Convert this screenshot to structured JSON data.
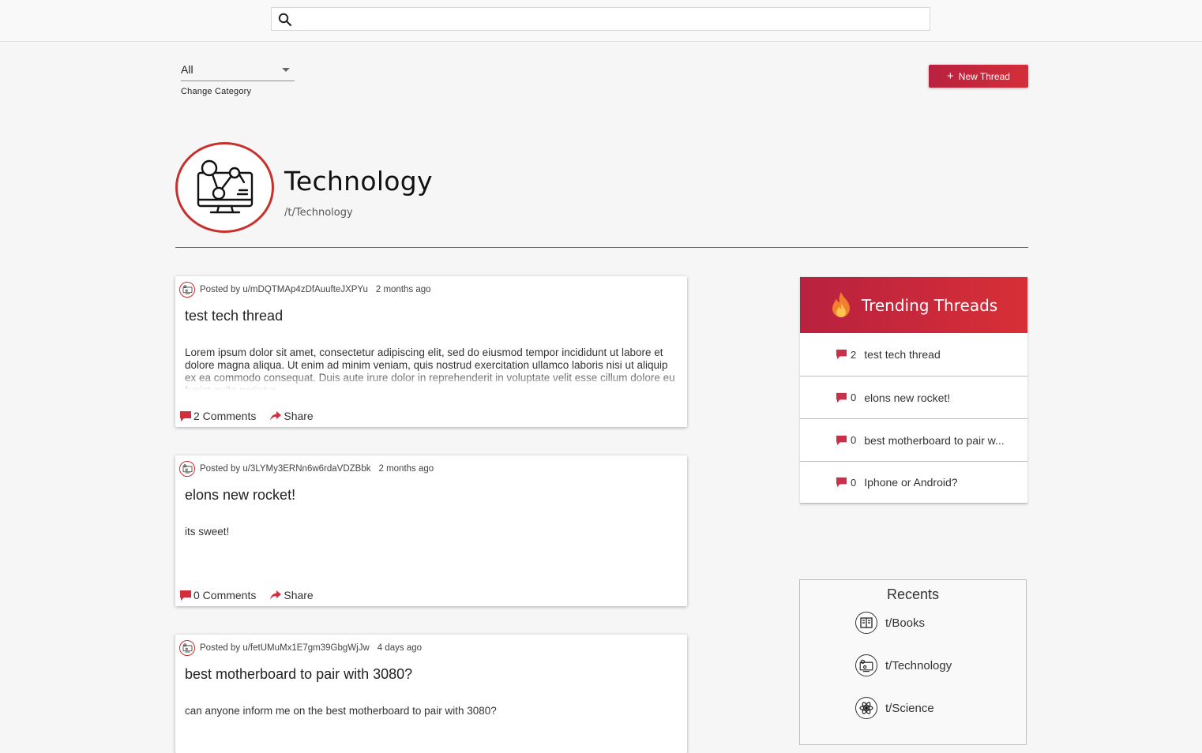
{
  "search": {
    "placeholder": "",
    "value": ""
  },
  "category": {
    "selected": "All",
    "helper": "Change Category"
  },
  "new_thread_label": "New Thread",
  "community": {
    "name": "Technology",
    "path": "/t/Technology"
  },
  "posts": [
    {
      "author": "Posted by u/mDQTMAp4zDfAuufteJXPYu",
      "time": "2 months ago",
      "title": "test tech thread",
      "body": "Lorem ipsum dolor sit amet, consectetur adipiscing elit, sed do eiusmod tempor incididunt ut labore et dolore magna aliqua. Ut enim ad minim veniam, quis nostrud exercitation ullamco laboris nisi ut aliquip ex ea commodo consequat. Duis aute irure dolor in reprehenderit in voluptate velit esse cillum dolore eu fugiat nulla pariatur.",
      "comments": "2 Comments",
      "share": "Share"
    },
    {
      "author": "Posted by u/3LYMy3ERNn6w6rdaVDZBbk",
      "time": "2 months ago",
      "title": "elons new rocket!",
      "body": "its sweet!",
      "comments": "0 Comments",
      "share": "Share"
    },
    {
      "author": "Posted by u/fetUMuMx1E7gm39GbgWjJw",
      "time": "4 days ago",
      "title": "best motherboard to pair with 3080?",
      "body": "can anyone inform me on the best motherboard to pair with 3080?",
      "comments": "",
      "share": ""
    }
  ],
  "trending": {
    "title": "Trending Threads",
    "items": [
      {
        "count": "2",
        "title": "test tech thread"
      },
      {
        "count": "0",
        "title": "elons new rocket!"
      },
      {
        "count": "0",
        "title": "best motherboard to pair w..."
      },
      {
        "count": "0",
        "title": "Iphone or Android?"
      }
    ]
  },
  "recents": {
    "title": "Recents",
    "items": [
      {
        "label": "t/Books",
        "icon": "book-icon"
      },
      {
        "label": "t/Technology",
        "icon": "technology-icon"
      },
      {
        "label": "t/Science",
        "icon": "atom-icon"
      }
    ]
  },
  "colors": {
    "accent": "#c9302c",
    "gradient_start": "#b8213f",
    "gradient_end": "#d82f37"
  }
}
